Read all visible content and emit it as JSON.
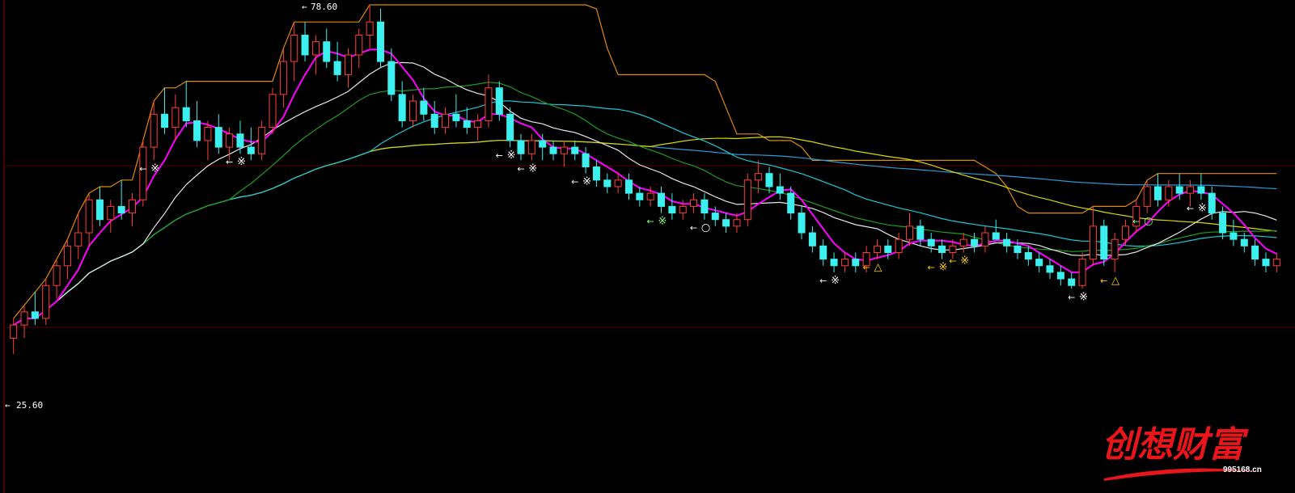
{
  "chart_data": {
    "type": "line",
    "subtype": "candlestick-with-moving-averages",
    "price_high_label": "78.60",
    "price_low_label": "25.60",
    "high_arrow": "←",
    "low_arrow": "←",
    "grid": true,
    "colors": {
      "background": "#000000",
      "up_candle": "#ff3d3d",
      "down_candle": "#3df0f0",
      "gridline": "#5a0000",
      "ma_magenta": "#ff00ff",
      "ma_white": "#e8e8e8",
      "ma_green": "#1f9a1f",
      "ma_cyan": "#19c8d8",
      "ma_yellow": "#d8d800",
      "ma_blue": "#2a9ad8",
      "stop_line": "#e08a00"
    },
    "candles": [
      {
        "o": 28,
        "h": 31,
        "l": 25.6,
        "c": 30
      },
      {
        "o": 30,
        "h": 33,
        "l": 28,
        "c": 32
      },
      {
        "o": 32,
        "h": 35,
        "l": 30,
        "c": 31
      },
      {
        "o": 31,
        "h": 37,
        "l": 30,
        "c": 36
      },
      {
        "o": 36,
        "h": 40,
        "l": 34,
        "c": 39
      },
      {
        "o": 39,
        "h": 43,
        "l": 37,
        "c": 42
      },
      {
        "o": 42,
        "h": 47,
        "l": 40,
        "c": 44
      },
      {
        "o": 44,
        "h": 50,
        "l": 42,
        "c": 49
      },
      {
        "o": 49,
        "h": 51,
        "l": 45,
        "c": 46
      },
      {
        "o": 46,
        "h": 49,
        "l": 44,
        "c": 48
      },
      {
        "o": 48,
        "h": 52,
        "l": 46,
        "c": 47
      },
      {
        "o": 47,
        "h": 50,
        "l": 45,
        "c": 49
      },
      {
        "o": 49,
        "h": 58,
        "l": 48,
        "c": 57
      },
      {
        "o": 57,
        "h": 64,
        "l": 55,
        "c": 62
      },
      {
        "o": 62,
        "h": 66,
        "l": 59,
        "c": 60
      },
      {
        "o": 60,
        "h": 65,
        "l": 58,
        "c": 63
      },
      {
        "o": 63,
        "h": 67,
        "l": 60,
        "c": 61
      },
      {
        "o": 61,
        "h": 64,
        "l": 57,
        "c": 58
      },
      {
        "o": 58,
        "h": 61,
        "l": 55,
        "c": 60
      },
      {
        "o": 60,
        "h": 62,
        "l": 56,
        "c": 57
      },
      {
        "o": 57,
        "h": 60,
        "l": 55,
        "c": 59
      },
      {
        "o": 59,
        "h": 61,
        "l": 56,
        "c": 57
      },
      {
        "o": 57,
        "h": 60,
        "l": 55,
        "c": 56
      },
      {
        "o": 56,
        "h": 61,
        "l": 55,
        "c": 60
      },
      {
        "o": 60,
        "h": 66,
        "l": 59,
        "c": 65
      },
      {
        "o": 65,
        "h": 72,
        "l": 63,
        "c": 70
      },
      {
        "o": 70,
        "h": 76,
        "l": 67,
        "c": 74
      },
      {
        "o": 74,
        "h": 76,
        "l": 70,
        "c": 71
      },
      {
        "o": 71,
        "h": 74,
        "l": 68,
        "c": 73
      },
      {
        "o": 73,
        "h": 75,
        "l": 69,
        "c": 70
      },
      {
        "o": 70,
        "h": 73,
        "l": 67,
        "c": 68
      },
      {
        "o": 68,
        "h": 72,
        "l": 66,
        "c": 71
      },
      {
        "o": 71,
        "h": 75,
        "l": 69,
        "c": 74
      },
      {
        "o": 74,
        "h": 78.6,
        "l": 72,
        "c": 76
      },
      {
        "o": 76,
        "h": 78,
        "l": 69,
        "c": 70
      },
      {
        "o": 70,
        "h": 72,
        "l": 64,
        "c": 65
      },
      {
        "o": 65,
        "h": 67,
        "l": 60,
        "c": 61
      },
      {
        "o": 61,
        "h": 65,
        "l": 60,
        "c": 64
      },
      {
        "o": 64,
        "h": 66,
        "l": 61,
        "c": 62
      },
      {
        "o": 62,
        "h": 64,
        "l": 59,
        "c": 60
      },
      {
        "o": 60,
        "h": 63,
        "l": 59,
        "c": 62
      },
      {
        "o": 62,
        "h": 65,
        "l": 60,
        "c": 61
      },
      {
        "o": 61,
        "h": 63,
        "l": 59,
        "c": 60
      },
      {
        "o": 60,
        "h": 62,
        "l": 58,
        "c": 61
      },
      {
        "o": 61,
        "h": 68,
        "l": 60,
        "c": 66
      },
      {
        "o": 66,
        "h": 67,
        "l": 61,
        "c": 62
      },
      {
        "o": 62,
        "h": 63,
        "l": 57,
        "c": 58
      },
      {
        "o": 58,
        "h": 59,
        "l": 55,
        "c": 56
      },
      {
        "o": 56,
        "h": 59,
        "l": 55,
        "c": 58
      },
      {
        "o": 58,
        "h": 59,
        "l": 55,
        "c": 57
      },
      {
        "o": 57,
        "h": 58,
        "l": 55,
        "c": 56
      },
      {
        "o": 56,
        "h": 58,
        "l": 54,
        "c": 57
      },
      {
        "o": 57,
        "h": 58,
        "l": 55,
        "c": 56
      },
      {
        "o": 56,
        "h": 57,
        "l": 53,
        "c": 54
      },
      {
        "o": 54,
        "h": 55,
        "l": 51,
        "c": 52
      },
      {
        "o": 52,
        "h": 53,
        "l": 50,
        "c": 51
      },
      {
        "o": 51,
        "h": 53,
        "l": 50,
        "c": 52
      },
      {
        "o": 52,
        "h": 53,
        "l": 49,
        "c": 50
      },
      {
        "o": 50,
        "h": 51,
        "l": 48,
        "c": 49
      },
      {
        "o": 49,
        "h": 51,
        "l": 48,
        "c": 50
      },
      {
        "o": 50,
        "h": 51,
        "l": 47,
        "c": 48
      },
      {
        "o": 48,
        "h": 50,
        "l": 46,
        "c": 47
      },
      {
        "o": 47,
        "h": 49,
        "l": 46,
        "c": 48
      },
      {
        "o": 48,
        "h": 50,
        "l": 47,
        "c": 49
      },
      {
        "o": 49,
        "h": 50,
        "l": 46,
        "c": 47
      },
      {
        "o": 47,
        "h": 48,
        "l": 45,
        "c": 46
      },
      {
        "o": 46,
        "h": 47,
        "l": 44,
        "c": 45
      },
      {
        "o": 45,
        "h": 47,
        "l": 44,
        "c": 46
      },
      {
        "o": 46,
        "h": 53,
        "l": 45,
        "c": 52
      },
      {
        "o": 52,
        "h": 55,
        "l": 50,
        "c": 53
      },
      {
        "o": 53,
        "h": 54,
        "l": 50,
        "c": 51
      },
      {
        "o": 51,
        "h": 53,
        "l": 49,
        "c": 50
      },
      {
        "o": 50,
        "h": 51,
        "l": 46,
        "c": 47
      },
      {
        "o": 47,
        "h": 48,
        "l": 43,
        "c": 44
      },
      {
        "o": 44,
        "h": 45,
        "l": 41,
        "c": 42
      },
      {
        "o": 42,
        "h": 43,
        "l": 39,
        "c": 40
      },
      {
        "o": 40,
        "h": 41,
        "l": 38,
        "c": 39
      },
      {
        "o": 39,
        "h": 41,
        "l": 38,
        "c": 40
      },
      {
        "o": 40,
        "h": 41,
        "l": 38,
        "c": 39
      },
      {
        "o": 39,
        "h": 42,
        "l": 38,
        "c": 41
      },
      {
        "o": 41,
        "h": 43,
        "l": 40,
        "c": 42
      },
      {
        "o": 42,
        "h": 43,
        "l": 40,
        "c": 41
      },
      {
        "o": 41,
        "h": 44,
        "l": 40,
        "c": 43
      },
      {
        "o": 43,
        "h": 47,
        "l": 42,
        "c": 45
      },
      {
        "o": 45,
        "h": 46,
        "l": 42,
        "c": 43
      },
      {
        "o": 43,
        "h": 44,
        "l": 41,
        "c": 42
      },
      {
        "o": 42,
        "h": 43,
        "l": 40,
        "c": 41
      },
      {
        "o": 41,
        "h": 43,
        "l": 40,
        "c": 42
      },
      {
        "o": 42,
        "h": 44,
        "l": 41,
        "c": 43
      },
      {
        "o": 43,
        "h": 44,
        "l": 41,
        "c": 42
      },
      {
        "o": 42,
        "h": 45,
        "l": 41,
        "c": 44
      },
      {
        "o": 44,
        "h": 46,
        "l": 43,
        "c": 43
      },
      {
        "o": 43,
        "h": 44,
        "l": 41,
        "c": 42
      },
      {
        "o": 42,
        "h": 43,
        "l": 40,
        "c": 41
      },
      {
        "o": 41,
        "h": 42,
        "l": 39,
        "c": 40
      },
      {
        "o": 40,
        "h": 41,
        "l": 38,
        "c": 39
      },
      {
        "o": 39,
        "h": 40,
        "l": 37,
        "c": 38
      },
      {
        "o": 38,
        "h": 39,
        "l": 36,
        "c": 37
      },
      {
        "o": 37,
        "h": 38,
        "l": 35.5,
        "c": 36
      },
      {
        "o": 36,
        "h": 41,
        "l": 35.5,
        "c": 40
      },
      {
        "o": 40,
        "h": 48,
        "l": 39,
        "c": 45
      },
      {
        "o": 45,
        "h": 46,
        "l": 39,
        "c": 40
      },
      {
        "o": 40,
        "h": 44,
        "l": 38,
        "c": 43
      },
      {
        "o": 43,
        "h": 46,
        "l": 42,
        "c": 45
      },
      {
        "o": 45,
        "h": 49,
        "l": 44,
        "c": 48
      },
      {
        "o": 48,
        "h": 52,
        "l": 47,
        "c": 51
      },
      {
        "o": 51,
        "h": 53,
        "l": 48,
        "c": 49
      },
      {
        "o": 49,
        "h": 52,
        "l": 48,
        "c": 51
      },
      {
        "o": 51,
        "h": 53,
        "l": 49,
        "c": 50
      },
      {
        "o": 50,
        "h": 52,
        "l": 48,
        "c": 51
      },
      {
        "o": 51,
        "h": 53,
        "l": 49,
        "c": 50
      },
      {
        "o": 50,
        "h": 51,
        "l": 46,
        "c": 47
      },
      {
        "o": 47,
        "h": 48,
        "l": 43,
        "c": 44
      },
      {
        "o": 44,
        "h": 46,
        "l": 42,
        "c": 43
      },
      {
        "o": 43,
        "h": 44,
        "l": 41,
        "c": 42
      },
      {
        "o": 42,
        "h": 43,
        "l": 39,
        "c": 40
      },
      {
        "o": 40,
        "h": 41,
        "l": 38,
        "c": 39
      },
      {
        "o": 39,
        "h": 41,
        "l": 38,
        "c": 40
      }
    ],
    "moving_averages": [
      {
        "color_key": "ma_magenta",
        "period": 5
      },
      {
        "color_key": "ma_white",
        "period": 13
      },
      {
        "color_key": "ma_green",
        "period": 21
      },
      {
        "color_key": "ma_cyan",
        "period": 34
      },
      {
        "color_key": "ma_yellow",
        "period": 60
      },
      {
        "color_key": "ma_blue",
        "period": 120
      }
    ],
    "markers": [
      {
        "idx": 13,
        "symbol": "※",
        "color": "#ffffff",
        "label": "←"
      },
      {
        "idx": 21,
        "symbol": "※",
        "color": "#ffffff",
        "label": "←"
      },
      {
        "idx": 46,
        "symbol": "※",
        "color": "#ffffff",
        "label": "←"
      },
      {
        "idx": 48,
        "symbol": "※",
        "color": "#ffffff",
        "label": "←"
      },
      {
        "idx": 53,
        "symbol": "※",
        "color": "#ffffff",
        "label": "←"
      },
      {
        "idx": 60,
        "symbol": "※",
        "color": "#7fff7f",
        "label": "←"
      },
      {
        "idx": 64,
        "symbol": "○",
        "color": "#ffffff",
        "label": "←"
      },
      {
        "idx": 76,
        "symbol": "※",
        "color": "#ffffff",
        "label": "←"
      },
      {
        "idx": 80,
        "symbol": "△",
        "color": "#ffd400",
        "label": "←"
      },
      {
        "idx": 86,
        "symbol": "※",
        "color": "#ffd400",
        "label": "←"
      },
      {
        "idx": 88,
        "symbol": "※",
        "color": "#ffd400",
        "label": "←"
      },
      {
        "idx": 99,
        "symbol": "※",
        "color": "#ffffff",
        "label": "←"
      },
      {
        "idx": 102,
        "symbol": "△",
        "color": "#ffd400",
        "label": "←"
      },
      {
        "idx": 105,
        "symbol": "○",
        "color": "#7fff7f",
        "label": "←"
      },
      {
        "idx": 110,
        "symbol": "※",
        "color": "#ffffff",
        "label": "←"
      }
    ],
    "watermark": {
      "text": "创想财富",
      "url": "995168.cn"
    }
  }
}
